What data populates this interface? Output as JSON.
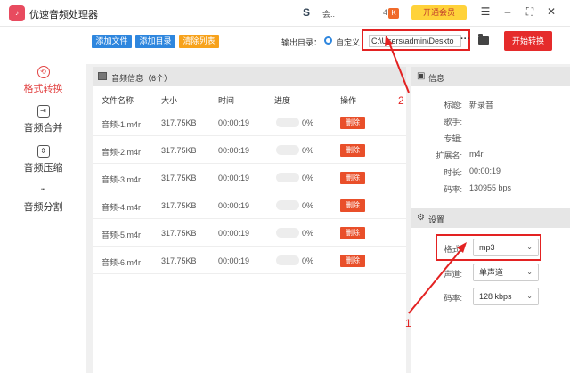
{
  "app": {
    "title": "优速音频处理器",
    "user_label": "会",
    "user_suffix": "..",
    "k_left": "4",
    "k_icon": "K",
    "vip_label": "开通会员",
    "menu_icon": "menu-icon",
    "min_icon": "minimize-icon",
    "max_icon": "maximize-icon",
    "close_icon": "close-icon"
  },
  "sidebar": {
    "items": [
      {
        "label": "格式转换",
        "icon": "refresh-icon",
        "glyph": "⟲",
        "active": true
      },
      {
        "label": "音频合并",
        "icon": "merge-icon",
        "glyph": "⇥",
        "active": false
      },
      {
        "label": "音频压缩",
        "icon": "compress-icon",
        "glyph": "⇕",
        "active": false
      },
      {
        "label": "音频分割",
        "icon": "split-icon",
        "glyph": "┅",
        "active": false
      }
    ]
  },
  "toolbar": {
    "add_file": "添加文件",
    "add_folder": "添加目录",
    "clear_list": "清除列表",
    "output_label": "输出目录：",
    "radio_label": "自定义",
    "output_path": "C:\\Users\\admin\\Deskto",
    "more": "···",
    "start": "开始转换"
  },
  "file_list": {
    "header": "音频信息（6个）",
    "columns": [
      "文件名称",
      "大小",
      "时间",
      "进度",
      "操作"
    ],
    "rows": [
      {
        "name": "音频-1.m4r",
        "size": "317.75KB",
        "time": "00:00:19",
        "progress": "0%",
        "action": "删除"
      },
      {
        "name": "音频-2.m4r",
        "size": "317.75KB",
        "time": "00:00:19",
        "progress": "0%",
        "action": "删除"
      },
      {
        "name": "音频-3.m4r",
        "size": "317.75KB",
        "time": "00:00:19",
        "progress": "0%",
        "action": "删除"
      },
      {
        "name": "音频-4.m4r",
        "size": "317.75KB",
        "time": "00:00:19",
        "progress": "0%",
        "action": "删除"
      },
      {
        "name": "音频-5.m4r",
        "size": "317.75KB",
        "time": "00:00:19",
        "progress": "0%",
        "action": "删除"
      },
      {
        "name": "音频-6.m4r",
        "size": "317.75KB",
        "time": "00:00:19",
        "progress": "0%",
        "action": "删除"
      }
    ]
  },
  "info": {
    "header": "信息",
    "fields": [
      {
        "label": "标题:",
        "value": "新录音"
      },
      {
        "label": "歌手:",
        "value": ""
      },
      {
        "label": "专辑:",
        "value": ""
      },
      {
        "label": "扩展名:",
        "value": "m4r"
      },
      {
        "label": "时长:",
        "value": "00:00:19"
      },
      {
        "label": "码率:",
        "value": "130955 bps"
      }
    ]
  },
  "settings": {
    "header": "设置",
    "format_label": "格式:",
    "format_value": "mp3",
    "channel_label": "声道:",
    "channel_value": "单声道",
    "bitrate_label": "码率:",
    "bitrate_value": "128 kbps"
  },
  "annotations": {
    "one": "1",
    "two": "2"
  },
  "colors": {
    "accent_red": "#e32222",
    "accent_blue": "#2e86de",
    "accent_orange": "#f7a21b"
  }
}
